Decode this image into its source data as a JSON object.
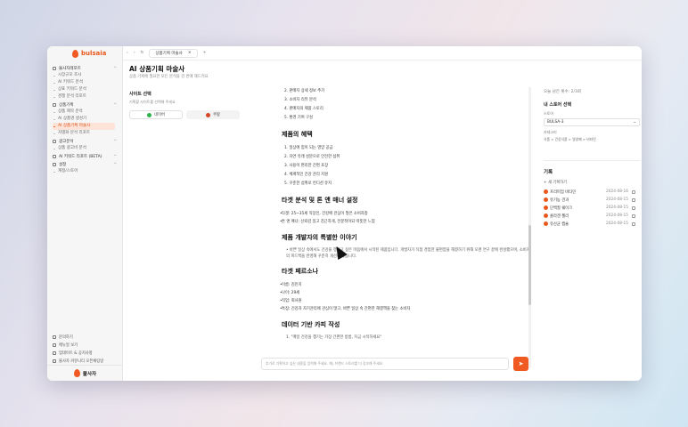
{
  "app": {
    "brand": "bulsaia",
    "footer_brand": "불사자"
  },
  "topbar": {
    "tab_label": "상품기획 마술사",
    "close": "×",
    "add": "+"
  },
  "sidebar": {
    "groups": [
      {
        "label": "불사자레포트",
        "items": [
          "시장규모 조사",
          "AI 키워드 분석",
          "상표 키워드 분석",
          "경쟁 분석 리포트"
        ]
      },
      {
        "label": "상품기획",
        "items": [
          "상품 제목 분석",
          "AI 상품명 생성기",
          "AI 상품기획 마술사",
          "차별화 분석 리포트"
        ],
        "active": 2
      },
      {
        "label": "광고분석",
        "items": [
          "상품 광고비 분석"
        ]
      },
      {
        "label": "AI 키워드 리포트 (BETA)",
        "items": []
      },
      {
        "label": "설정",
        "items": [
          "계정/스토어"
        ]
      }
    ],
    "footer": [
      "문의하기",
      "매뉴얼 보기",
      "업데이트 & 공지사항",
      "불사자 커뮤니티 오픈채팅방"
    ]
  },
  "page": {
    "title": "AI 상품기획 마술사",
    "subtitle": "상품 기획에 필요한 모든 분석을 한 번에 해드려요"
  },
  "panel": {
    "title": "사이트 선택",
    "subtitle": "기획할 사이트를 선택해 주세요",
    "opt1": "네이버",
    "opt2": "쿠팡"
  },
  "content": {
    "top_items": [
      "2. 판매자 상세 정보 추가",
      "3. 소비자 리뷰 분석",
      "4. 판매자의 제품 스토리",
      "5. 환경 기여 구성"
    ],
    "h1": "제품의 혜택",
    "benefits": [
      "1. 일상에 힘이 되는 영양 공급",
      "2. 자연 유래 성분으로 안전한 섭취",
      "3. 사용이 편리한 간편 포장",
      "4. 체계적인 건강 관리 지원",
      "5. 꾸준한 섭취로 컨디션 유지"
    ],
    "h2": "타겟 분석 및 톤 앤 매너 설정",
    "target_bullets": [
      "타겟: 25~35세 직장인, 건강에 관심이 많은 소비자층",
      "톤 앤 매너: 신뢰감 있고 친근하게, 전문적이되 따뜻한 느낌"
    ],
    "h3": "제품 개발자의 특별한 이야기",
    "story": "• 바쁜 일상 속에서도 건강을 챙기고 싶은 마음에서 시작된 제품입니다. 개발자가 직접 경험한 불편함을 해결하기 위해 오랜 연구 끝에 완성했으며, 소비자의 피드백을 반영해 꾸준히 개선해 왔습니다.",
    "h4": "타겟 페르소나",
    "persona": [
      "이름: 김민지",
      "나이: 29세",
      "직업: 회사원",
      "특징: 건강과 자기관리에 관심이 많고, 바쁜 일상 속 간편한 해결책을 찾는 소비자"
    ],
    "h5": "데이터 기반 카피 작성",
    "copy1": "1. \"매일 건강을 챙기는 가장 간편한 방법, 지금 시작하세요\""
  },
  "input": {
    "placeholder": "추가로 기획하고 싶은 내용을 입력해 주세요. 예) 브랜드 스토리를 더 강조해 주세요",
    "send": "➤"
  },
  "right": {
    "top": "오늘 남은 횟수: 2/3회",
    "head": "내 스토어 선택",
    "store_label": "스토어",
    "store_value": "BULSA-3",
    "category_label": "카테고리",
    "category_value": "식품 > 건강식품 > 영양제 > 비타민",
    "records_title": "기록",
    "new": "+ 새 기획하기",
    "history": [
      {
        "name": "프리미엄 비타민",
        "date": "2024-08-16"
      },
      {
        "name": "유기농 견과",
        "date": "2024-08-15"
      },
      {
        "name": "단백질 쉐이크",
        "date": "2024-08-15"
      },
      {
        "name": "콜라겐 젤리",
        "date": "2024-08-15"
      },
      {
        "name": "유산균 캡슐",
        "date": "2024-08-15"
      }
    ]
  },
  "colors": {
    "accent": "#f05a22",
    "active_bg": "#fde3d8"
  }
}
